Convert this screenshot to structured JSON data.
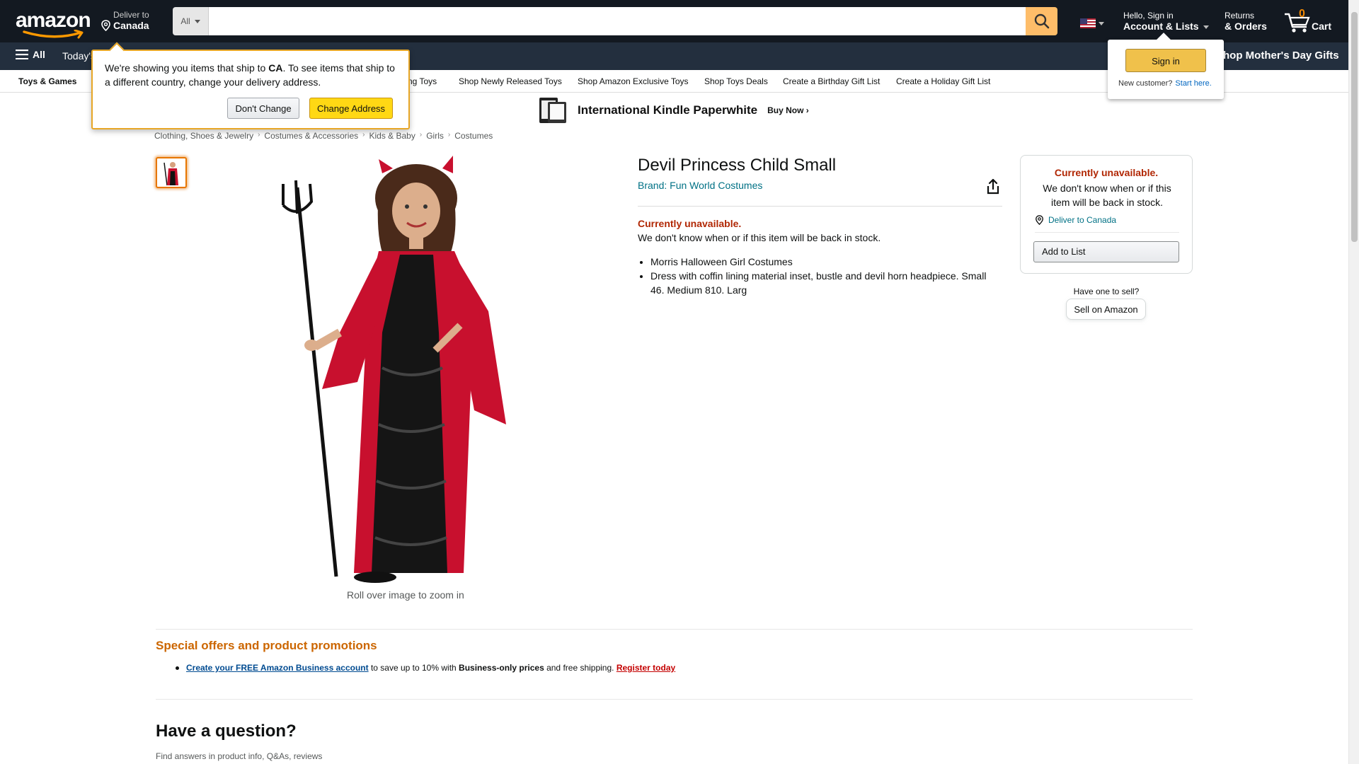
{
  "header": {
    "logo_text": "amazon",
    "deliver_line1": "Deliver to",
    "deliver_line2": "Canada",
    "search_category": "All",
    "search_placeholder": "",
    "account_line1": "Hello, Sign in",
    "account_line2": "Account & Lists",
    "returns_line1": "Returns",
    "returns_line2": "& Orders",
    "cart_count": "0",
    "cart_label": "Cart"
  },
  "subnav": {
    "all_label": "All",
    "todays_label": "Today's",
    "promo_label": "Shop Mother's Day Gifts"
  },
  "catbar": {
    "main": "Toys & Games",
    "items": [
      "lling Toys",
      "Shop Newly Released Toys",
      "Shop Amazon Exclusive Toys",
      "Shop Toys Deals",
      "Create a Birthday Gift List",
      "Create a Holiday Gift List"
    ]
  },
  "banner": {
    "title": "International Kindle Paperwhite",
    "cta": "Buy Now ›"
  },
  "breadcrumbs": [
    "Clothing, Shoes & Jewelry",
    "Costumes & Accessories",
    "Kids & Baby",
    "Girls",
    "Costumes"
  ],
  "product": {
    "title": "Devil Princess Child Small",
    "brand": "Brand: Fun World Costumes",
    "unavailable": "Currently unavailable.",
    "unavailable_note": "We don't know when or if this item will be back in stock.",
    "bullets": [
      "Morris Halloween Girl Costumes",
      "Dress with coffin lining material inset, bustle and devil horn headpiece. Small 46. Medium 810. Larg"
    ],
    "zoom_hint": "Roll over image to zoom in"
  },
  "buybox": {
    "unavailable": "Currently unavailable.",
    "note": "We don't know when or if this item will be back in stock.",
    "deliver": "Deliver to Canada",
    "add_to_list": "Add to List",
    "sell_question": "Have one to sell?",
    "sell_button": "Sell on Amazon"
  },
  "offers": {
    "title": "Special offers and product promotions",
    "link": "Create your FREE Amazon Business account",
    "text1": " to save up to 10% with ",
    "bold": "Business-only prices",
    "text2": " and free shipping. ",
    "register": "Register today"
  },
  "question": {
    "title": "Have a question?",
    "subtitle": "Find answers in product info, Q&As, reviews"
  },
  "popover_address": {
    "message_pre": "We're showing you items that ship to ",
    "country": "CA",
    "message_post": ". To see items that ship to a different country, change your delivery address.",
    "dont_change": "Don't Change",
    "change_address": "Change Address"
  },
  "popover_signin": {
    "sign_in": "Sign in",
    "new_customer": "New customer?",
    "start_here": "Start here."
  },
  "colors": {
    "nav_bg": "#131921",
    "subnav_bg": "#232f3e",
    "search_button": "#febd69",
    "unavailable_red": "#b12704",
    "link_teal": "#007185",
    "offer_orange": "#cc6600",
    "primary_yellow": "#ffd814"
  }
}
